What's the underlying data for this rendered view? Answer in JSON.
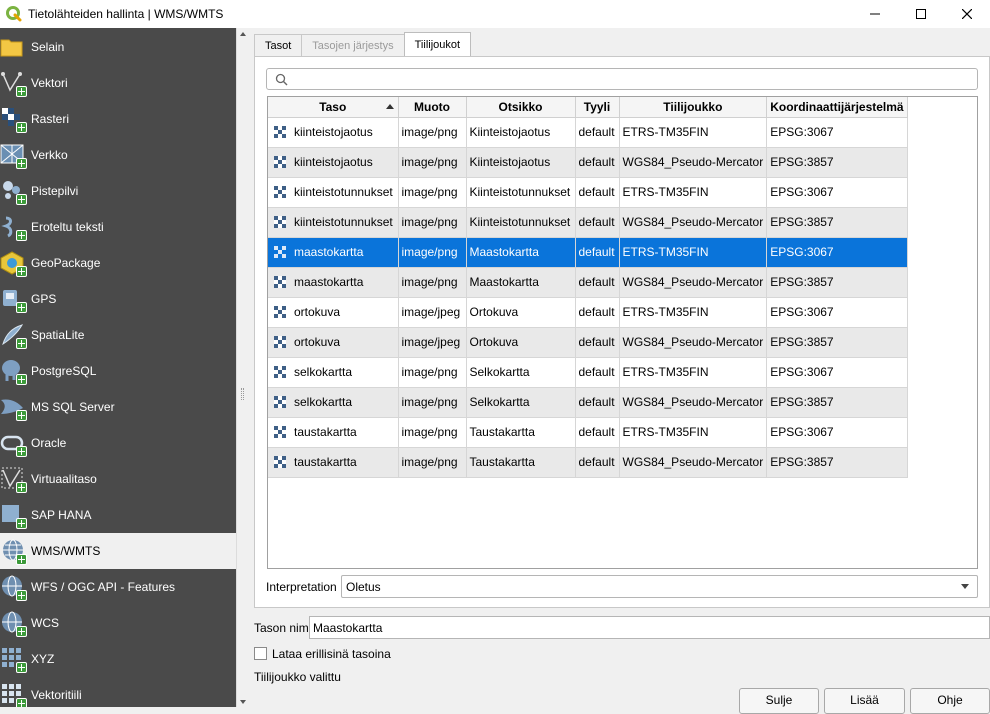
{
  "window": {
    "title": "Tietolähteiden hallinta | WMS/WMTS",
    "minimize_icon": "minimize-icon",
    "maximize_icon": "maximize-icon",
    "close_icon": "close-icon"
  },
  "sidebar": {
    "items": [
      {
        "label": "Selain",
        "icon": "folder-icon"
      },
      {
        "label": "Vektori",
        "icon": "vector-icon"
      },
      {
        "label": "Rasteri",
        "icon": "raster-icon"
      },
      {
        "label": "Verkko",
        "icon": "mesh-icon"
      },
      {
        "label": "Pistepilvi",
        "icon": "point-cloud-icon"
      },
      {
        "label": "Eroteltu teksti",
        "icon": "delimited-text-icon"
      },
      {
        "label": "GeoPackage",
        "icon": "geopackage-icon"
      },
      {
        "label": "GPS",
        "icon": "gps-icon"
      },
      {
        "label": "SpatiaLite",
        "icon": "spatialite-icon"
      },
      {
        "label": "PostgreSQL",
        "icon": "postgresql-icon"
      },
      {
        "label": "MS SQL Server",
        "icon": "mssql-icon"
      },
      {
        "label": "Oracle",
        "icon": "oracle-icon"
      },
      {
        "label": "Virtuaalitaso",
        "icon": "virtual-layer-icon"
      },
      {
        "label": "SAP HANA",
        "icon": "sap-hana-icon"
      },
      {
        "label": "WMS/WMTS",
        "icon": "wms-icon"
      },
      {
        "label": "WFS / OGC API - Features",
        "icon": "wfs-icon"
      },
      {
        "label": "WCS",
        "icon": "wcs-icon"
      },
      {
        "label": "XYZ",
        "icon": "xyz-icon"
      },
      {
        "label": "Vektoritiili",
        "icon": "vector-tile-icon"
      }
    ],
    "active_index": 14
  },
  "tabs": [
    {
      "label": "Tasot",
      "state": "normal"
    },
    {
      "label": "Tasojen järjestys",
      "state": "disabled"
    },
    {
      "label": "Tiilijoukot",
      "state": "selected"
    }
  ],
  "search": {
    "value": "",
    "placeholder": "",
    "icon": "search-icon"
  },
  "table": {
    "columns": [
      "Taso",
      "Muoto",
      "Otsikko",
      "Tyyli",
      "Tiilijoukko",
      "Koordinaattijärjestelmä"
    ],
    "sorted_column": "Taso",
    "rows": [
      [
        "kiinteistojaotus",
        "image/png",
        "Kiinteistojaotus",
        "default",
        "ETRS-TM35FIN",
        "EPSG:3067"
      ],
      [
        "kiinteistojaotus",
        "image/png",
        "Kiinteistojaotus",
        "default",
        "WGS84_Pseudo-Mercator",
        "EPSG:3857"
      ],
      [
        "kiinteistotunnukset",
        "image/png",
        "Kiinteistotunnukset",
        "default",
        "ETRS-TM35FIN",
        "EPSG:3067"
      ],
      [
        "kiinteistotunnukset",
        "image/png",
        "Kiinteistotunnukset",
        "default",
        "WGS84_Pseudo-Mercator",
        "EPSG:3857"
      ],
      [
        "maastokartta",
        "image/png",
        "Maastokartta",
        "default",
        "ETRS-TM35FIN",
        "EPSG:3067"
      ],
      [
        "maastokartta",
        "image/png",
        "Maastokartta",
        "default",
        "WGS84_Pseudo-Mercator",
        "EPSG:3857"
      ],
      [
        "ortokuva",
        "image/jpeg",
        "Ortokuva",
        "default",
        "ETRS-TM35FIN",
        "EPSG:3067"
      ],
      [
        "ortokuva",
        "image/jpeg",
        "Ortokuva",
        "default",
        "WGS84_Pseudo-Mercator",
        "EPSG:3857"
      ],
      [
        "selkokartta",
        "image/png",
        "Selkokartta",
        "default",
        "ETRS-TM35FIN",
        "EPSG:3067"
      ],
      [
        "selkokartta",
        "image/png",
        "Selkokartta",
        "default",
        "WGS84_Pseudo-Mercator",
        "EPSG:3857"
      ],
      [
        "taustakartta",
        "image/png",
        "Taustakartta",
        "default",
        "ETRS-TM35FIN",
        "EPSG:3067"
      ],
      [
        "taustakartta",
        "image/png",
        "Taustakartta",
        "default",
        "WGS84_Pseudo-Mercator",
        "EPSG:3857"
      ]
    ],
    "selected_row": 4,
    "row_icon": "tileset-icon"
  },
  "interpretation": {
    "label": "Interpretation",
    "value": "Oletus"
  },
  "layer_name": {
    "label": "Tason nimi",
    "value": "Maastokartta"
  },
  "separate_layers": {
    "label": "Lataa erillisinä tasoina",
    "checked": false
  },
  "status_text": "Tiilijoukko valittu",
  "buttons": {
    "close": "Sulje",
    "add": "Lisää",
    "help": "Ohje"
  },
  "colors": {
    "selection": "#0a74da",
    "sidebar_bg": "#4a4a4a",
    "plus_badge": "#3c9a3a"
  }
}
